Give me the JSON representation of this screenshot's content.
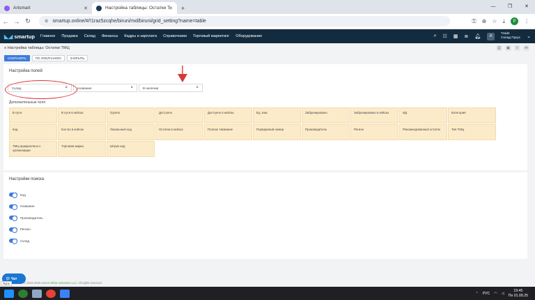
{
  "browser": {
    "tabs": [
      {
        "label": "Artsmart",
        "active": false
      },
      {
        "label": "Настройка таблицы: Остатки Т",
        "active": true
      }
    ],
    "url": "smartup.online/#/!1raz5zcqhe/biruni/md/biruni/grid_setting?name=table",
    "profile_letter": "P"
  },
  "app": {
    "logo": "smartup",
    "menu": [
      "Главное",
      "Продажа",
      "Склад",
      "Финансы",
      "Кадры и зарплата",
      "Справочники",
      "Торговый маркетинг",
      "Оборудование"
    ],
    "user": {
      "avatar": "A",
      "name": "Trade",
      "role": "Склад Пукус"
    }
  },
  "page": {
    "title": "≡ Настройка таблицы: Остатки ТМЦ",
    "actions": {
      "save": "СОХРАНИТЬ",
      "default": "ПО УМОЛЧАНИЮ",
      "close": "ЗАКРЫТЬ"
    },
    "fields_section": {
      "title": "Настройка полей",
      "selected": [
        "Склад",
        "Название",
        "В наличии"
      ],
      "additional_title": "Дополнительные поля",
      "additional": [
        "В пути",
        "В пути в кейсах",
        "Группа",
        "Доступно",
        "Доступно в кейсах",
        "Ед. изм.",
        "Забронировано",
        "Забронировано в кейсах",
        "ИД",
        "Категория",
        "Код",
        "Кол-во в кейсах",
        "Локальный код",
        "Остатки в кейсах",
        "Полное Название",
        "Порядковый номер",
        "Производитель",
        "Регион",
        "Рекомендованный остаток",
        "Тип ТМЦ",
        "ТМЦ прикреплено к организации",
        "Торговая марка",
        "Штрих-код"
      ]
    },
    "search_section": {
      "title": "Настройки поиска",
      "items": [
        "Код",
        "Название",
        "Производитель",
        "Регион",
        "Склад"
      ]
    },
    "footer": {
      "copy": "© 2015-2025 ",
      "company": "Green White Solutions LLC",
      "rights": ". All rights reserved."
    },
    "chat_label": "Чат",
    "chat_tip": "Пуск"
  },
  "taskbar": {
    "lang": "РУС",
    "time": "19:45",
    "date": "Пн 01.09.25"
  },
  "colors": {
    "primary": "#3e7bdb",
    "nav": "#132b3e",
    "field_cell": "#fcebc9",
    "annotation": "#d93636"
  }
}
